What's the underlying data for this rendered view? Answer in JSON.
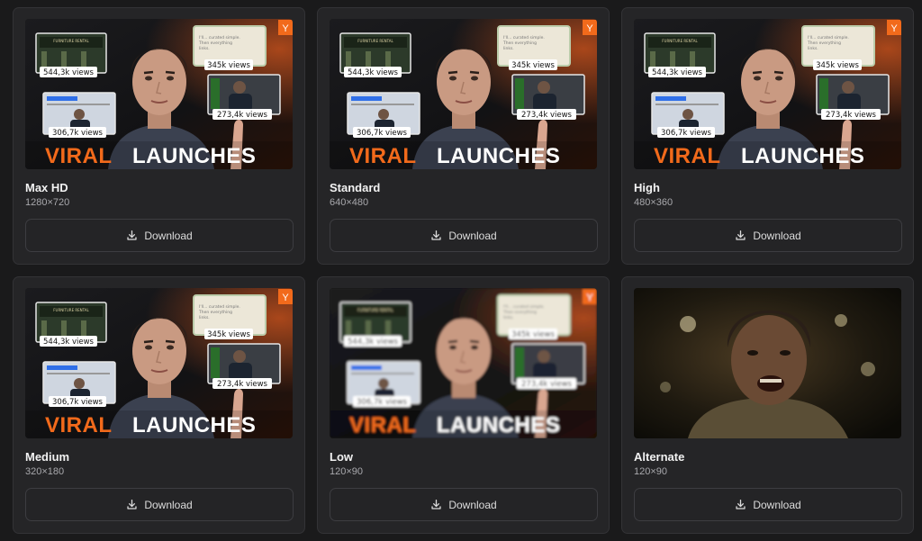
{
  "thumbnail_text": {
    "headline_accent": "VIRAL",
    "headline_main": "LAUNCHES",
    "badge": "Y",
    "views_a": "544,3k views",
    "views_b": "345k views",
    "views_c": "273,4k views",
    "views_d": "306,7k views",
    "sign": "FURNITURE RENTAL",
    "note_lines": [
      "I'll... curated simple.",
      "Then everything",
      "links."
    ]
  },
  "cards": [
    {
      "title": "Max HD",
      "resolution": "1280×720",
      "download_label": "Download"
    },
    {
      "title": "Standard",
      "resolution": "640×480",
      "download_label": "Download"
    },
    {
      "title": "High",
      "resolution": "480×360",
      "download_label": "Download"
    },
    {
      "title": "Medium",
      "resolution": "320×180",
      "download_label": "Download"
    },
    {
      "title": "Low",
      "resolution": "120×90",
      "download_label": "Download"
    },
    {
      "title": "Alternate",
      "resolution": "120×90",
      "download_label": "Download"
    }
  ],
  "colors": {
    "background": "#1a1a1b",
    "card": "#252527",
    "accent_orange": "#f26a1b"
  },
  "icons": {
    "download": "download-icon",
    "badge": "brand-badge-icon"
  }
}
